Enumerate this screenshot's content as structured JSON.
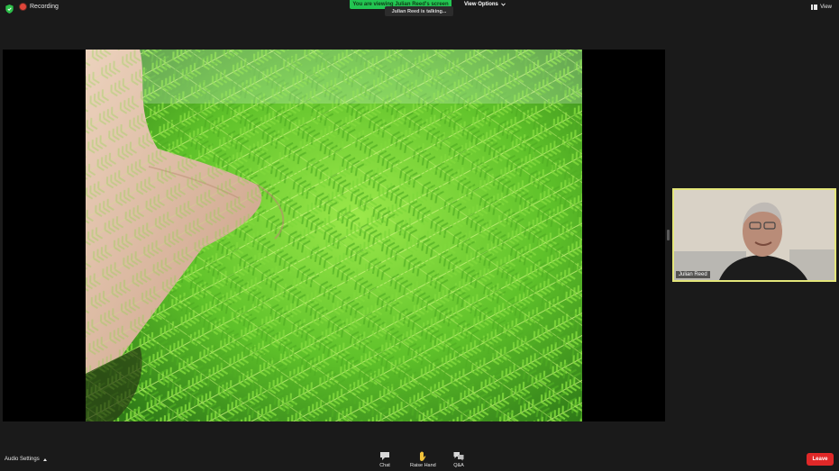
{
  "topbar": {
    "recording_label": "Recording",
    "viewing_banner": "You are viewing Julian Reed's screen",
    "talking_label": "Julian Reed is talking...",
    "view_options_label": "View Options",
    "view_label": "View"
  },
  "thumbnail": {
    "name": "Julian Reed"
  },
  "bottombar": {
    "audio_settings_label": "Audio Settings",
    "chat_label": "Chat",
    "raise_hand_label": "Raise Hand",
    "qa_label": "Q&A",
    "leave_label": "Leave"
  },
  "colors": {
    "accent_green": "#23c552",
    "leave_red": "#e02828",
    "active_speaker_border": "#e4e67a"
  }
}
